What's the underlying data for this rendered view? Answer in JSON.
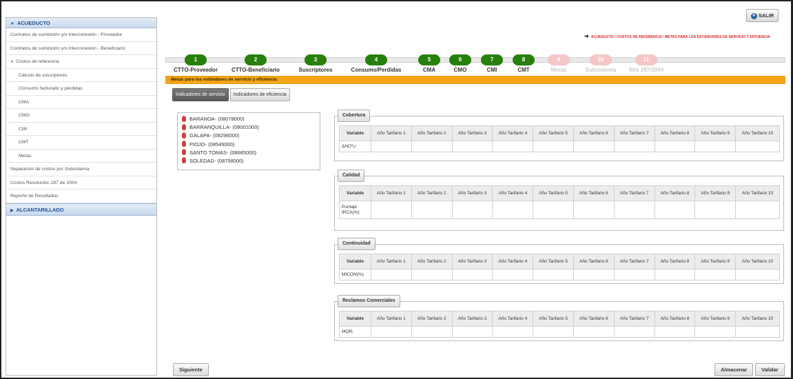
{
  "sidebar": {
    "header": "ACUEDUCTO",
    "items": [
      {
        "label": "Contratos de suministro y/o interconexión - Proveedor",
        "sub": false,
        "arrow": false
      },
      {
        "label": "Contratos de suministro y/o interconexión - Beneficiario",
        "sub": false,
        "arrow": false
      },
      {
        "label": "Costos de referencia",
        "sub": false,
        "arrow": true
      },
      {
        "label": "Cálculo de suscriptores",
        "sub": true,
        "arrow": false
      },
      {
        "label": "Consumo facturado y pérdidas",
        "sub": true,
        "arrow": false
      },
      {
        "label": "CMA",
        "sub": true,
        "arrow": false
      },
      {
        "label": "CMO",
        "sub": true,
        "arrow": false
      },
      {
        "label": "CMI",
        "sub": true,
        "arrow": false
      },
      {
        "label": "CMT",
        "sub": true,
        "arrow": false
      },
      {
        "label": "Metas",
        "sub": true,
        "arrow": false
      },
      {
        "label": "Separación de costos por Subsistema",
        "sub": false,
        "arrow": false
      },
      {
        "label": "Costos Resolución 287 de 2004",
        "sub": false,
        "arrow": false
      },
      {
        "label": "Reporte de Resultados",
        "sub": false,
        "arrow": false
      }
    ],
    "footer": "ALCANTARILLADO"
  },
  "salir_label": "SALIR",
  "breadcrumb": "ACUEDUCTO / COSTOS DE REFERENCIA / METAS PARA LOS ESTÁNDARES DE SERVICIO Y EFICIENCIA",
  "steps": [
    {
      "num": "1",
      "label": "CTTO-Proveedor",
      "active": true
    },
    {
      "num": "2",
      "label": "CTTO-Beneficiario",
      "active": true
    },
    {
      "num": "3",
      "label": "Suscriptores",
      "active": true
    },
    {
      "num": "4",
      "label": "Consumo/Perdidas",
      "active": true
    },
    {
      "num": "5",
      "label": "CMA",
      "active": true
    },
    {
      "num": "6",
      "label": "CMO",
      "active": true
    },
    {
      "num": "7",
      "label": "CMI",
      "active": true
    },
    {
      "num": "8",
      "label": "CMT",
      "active": true
    },
    {
      "num": "9",
      "label": "Metas",
      "active": false
    },
    {
      "num": "10",
      "label": "Subsistema",
      "active": false
    },
    {
      "num": "11",
      "label": "Res 287/2004",
      "active": false
    }
  ],
  "section_title": "Metas para los estándares de servicio y eficiencia",
  "tabs": {
    "servicio": "Indicadores de servicio",
    "eficiencia": "Indicadores de eficiencia"
  },
  "tree": [
    "BARANOA- (08078000)",
    "BARRANQUILLA- (08001000)",
    "GALAPA- (08296000)",
    "PIOJO- (08549000)",
    "SANTO TOMAS- (08685000)",
    "SOLEDAD- (08758000)"
  ],
  "variable_header": "Variable",
  "tables": [
    {
      "title": "Cobertura",
      "columns": [
        "Año Tarifario 1",
        "Año Tarifario 2",
        "Año Tarifario 3",
        "Año Tarifario 4",
        "Año Tarifario 5",
        "Año Tarifario 6",
        "Año Tarifario 7",
        "Año Tarifario 8",
        "Año Tarifario 9",
        "Año Tarifario 10"
      ],
      "row": "ΔNCᴿₐᶜ"
    },
    {
      "title": "Calidad",
      "columns": [
        "Año Tarifario 1",
        "Año Tarifario 2",
        "Año Tarifario 3",
        "Año Tarifario 4",
        "Año Tarifario 5",
        "Año Tarifario 6",
        "Año Tarifario 7",
        "Año Tarifario 8",
        "Año Tarifario 9",
        "Año Tarifario 10"
      ],
      "row": "Puntaje IRCA(%)"
    },
    {
      "title": "Continuidad",
      "columns": [
        "Año Tarifario 1",
        "Año Tarifario 2",
        "Año Tarifario 3",
        "Año Tarifario 4",
        "Año Tarifario 5",
        "Año Tarifario 6",
        "Año Tarifario 7",
        "Año Tarifario 8",
        "Año Tarifario 9",
        "Año Tarifario 10"
      ],
      "row": "MICON(%)"
    },
    {
      "title": "Reclamos Comerciales",
      "columns": [
        "Año Tarifario 1",
        "Año Tarifario 2",
        "Año Tarifario 3",
        "Año Tarifario 4",
        "Año Tarifario 5",
        "Año Tarifario 6",
        "Año Tarifario 7",
        "Año Tarifario 8",
        "Año Tarifario 9",
        "Año Tarifario 10"
      ],
      "row": "MQRᵢ"
    }
  ],
  "buttons": {
    "siguiente": "Siguiente",
    "almacenar": "Almacenar",
    "validar": "Validar"
  },
  "colors": {
    "band": "#f2a317",
    "step_active": "#27800d",
    "step_inactive": "#f5c6c6",
    "breadcrumb": "#e02020"
  }
}
